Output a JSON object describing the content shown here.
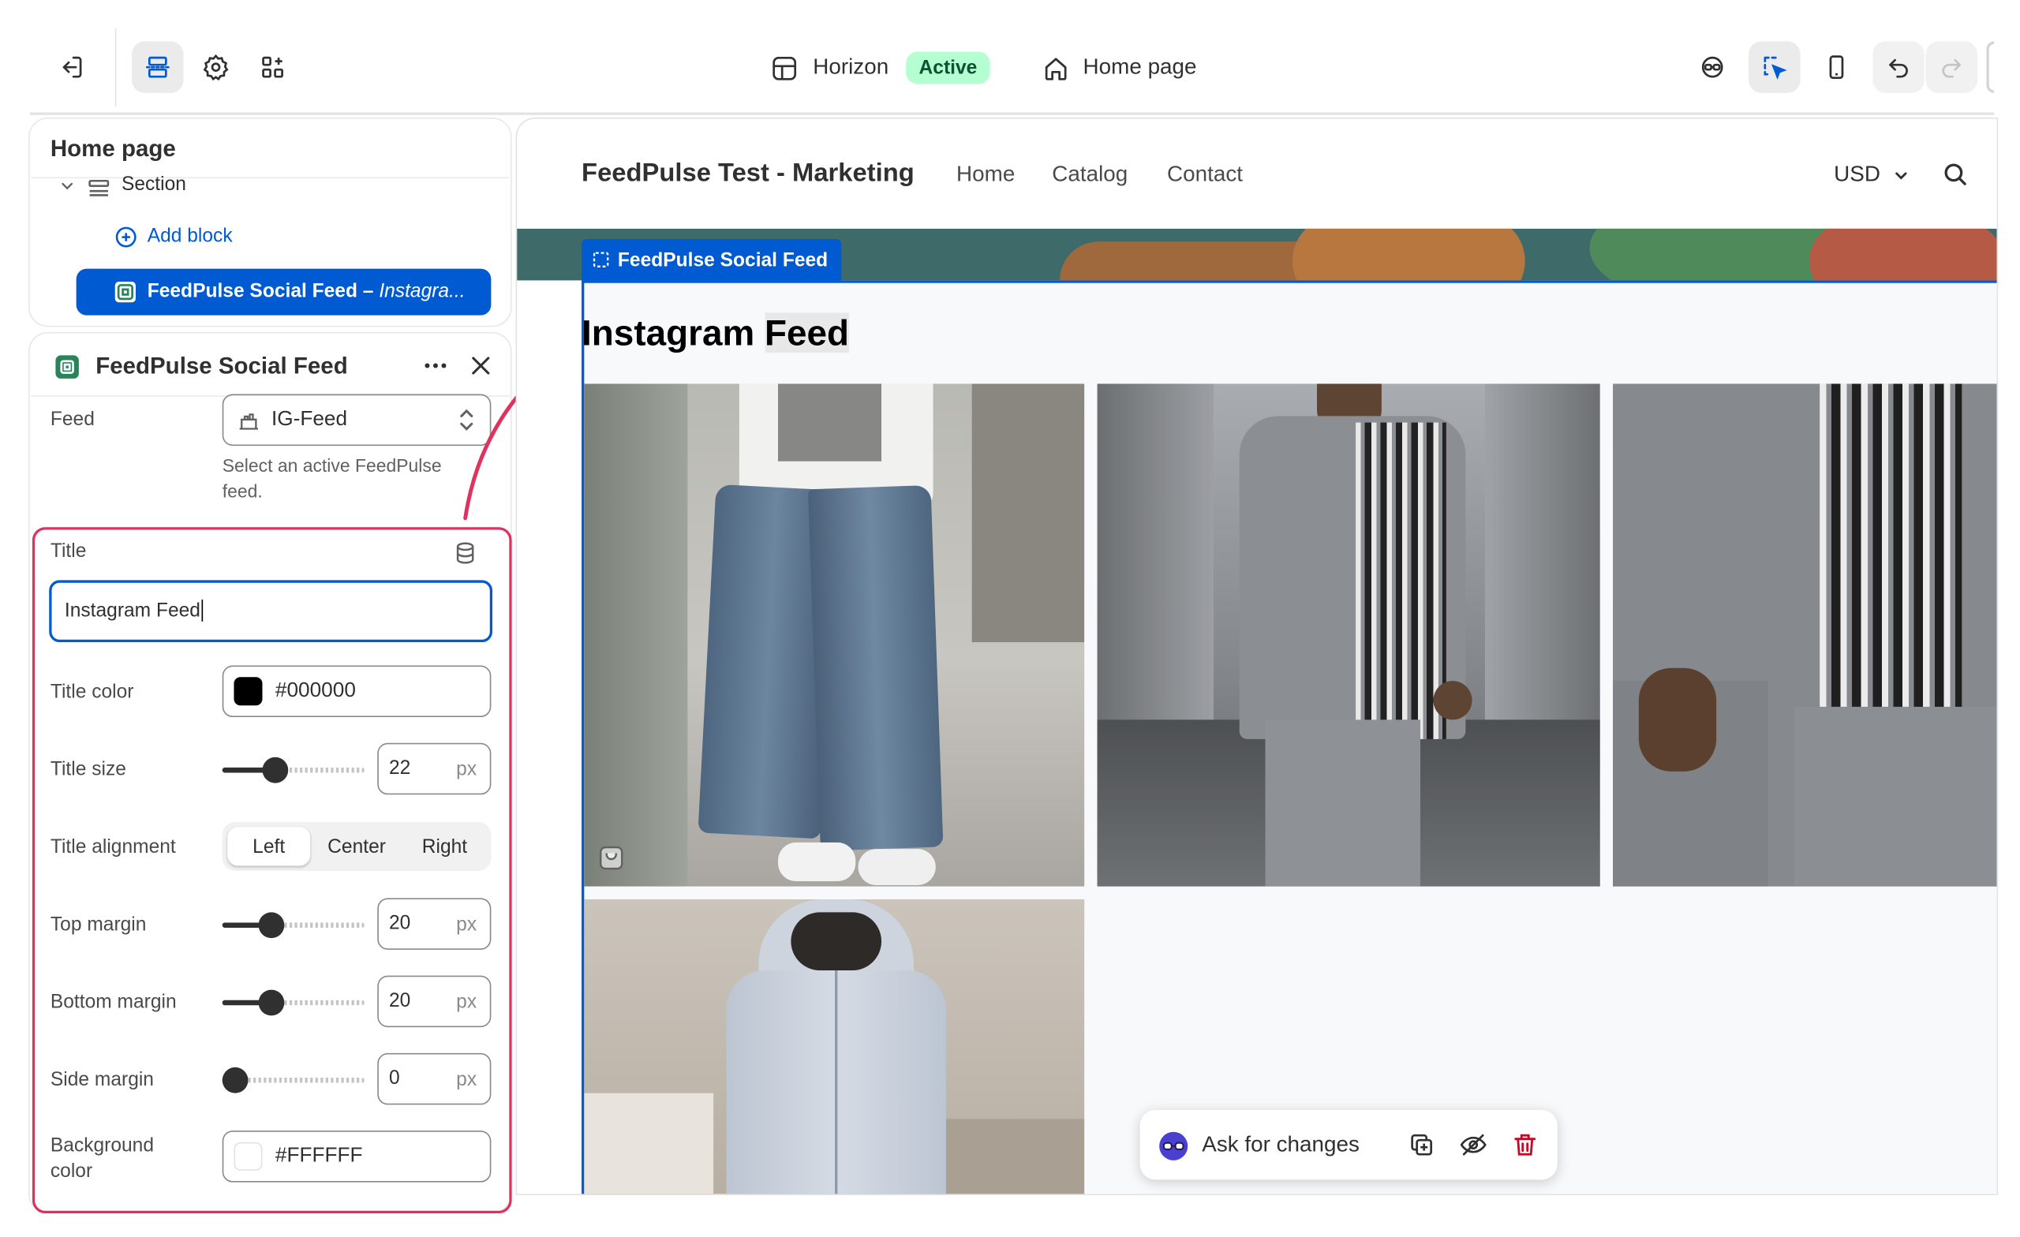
{
  "topbar": {
    "theme_name": "Horizon",
    "theme_status": "Active",
    "page_selector": "Home page"
  },
  "sidebar": {
    "page_title": "Home page",
    "tree": {
      "section_label": "Section",
      "add_block_label": "Add block",
      "selected_block_label": "FeedPulse Social Feed – ",
      "selected_block_suffix": "Instagra..."
    }
  },
  "settings": {
    "panel_title": "FeedPulse Social Feed",
    "feed": {
      "label": "Feed",
      "value": "IG-Feed",
      "help": "Select an active FeedPulse feed."
    },
    "title": {
      "label": "Title",
      "value": "Instagram Feed"
    },
    "title_color": {
      "label": "Title color",
      "value": "#000000",
      "swatch": "#000000"
    },
    "title_size": {
      "label": "Title size",
      "value": "22",
      "unit": "px",
      "level": 0.28
    },
    "title_alignment": {
      "label": "Title alignment",
      "options": [
        "Left",
        "Center",
        "Right"
      ],
      "selected": "Left"
    },
    "top_margin": {
      "label": "Top margin",
      "value": "20",
      "unit": "px",
      "level": 0.25
    },
    "bottom_margin": {
      "label": "Bottom margin",
      "value": "20",
      "unit": "px",
      "level": 0.25
    },
    "side_margin": {
      "label": "Side margin",
      "value": "0",
      "unit": "px",
      "level": 0.0
    },
    "background_color": {
      "label_line1": "Background",
      "label_line2": "color",
      "value": "#FFFFFF",
      "swatch": "#FFFFFF"
    }
  },
  "preview": {
    "store_name": "FeedPulse Test - Marketing",
    "nav": [
      "Home",
      "Catalog",
      "Contact"
    ],
    "currency": "USD",
    "section_tag": "FeedPulse Social Feed",
    "feed_title_part1": "Instagram ",
    "feed_title_part2": "Feed",
    "photos": [
      "baggy-jeans-street",
      "grey-striped-shirt-street",
      "grey-striped-shirt-closeup",
      "light-grey-hoodie-set"
    ]
  },
  "ask_bar": {
    "label": "Ask for changes"
  },
  "colors": {
    "accent": "#005bd3",
    "highlight": "#e0315f",
    "active_badge_bg": "#b4fed2",
    "delete_red": "#c70a24"
  },
  "icons": [
    "exit-icon",
    "sections-icon",
    "gear-icon",
    "apps-icon",
    "theme-icon",
    "home-icon",
    "inspector-icon",
    "inspect-icon",
    "mobile-icon",
    "undo-icon",
    "redo-icon",
    "chevron-down-icon",
    "section-icon",
    "plus-circle-icon",
    "block-app-icon",
    "more-icon",
    "close-icon",
    "feed-icon",
    "select-arrows-icon",
    "database-icon",
    "search-icon",
    "shopping-bag-icon",
    "sidekick-icon",
    "duplicate-icon",
    "hide-icon",
    "delete-icon"
  ]
}
